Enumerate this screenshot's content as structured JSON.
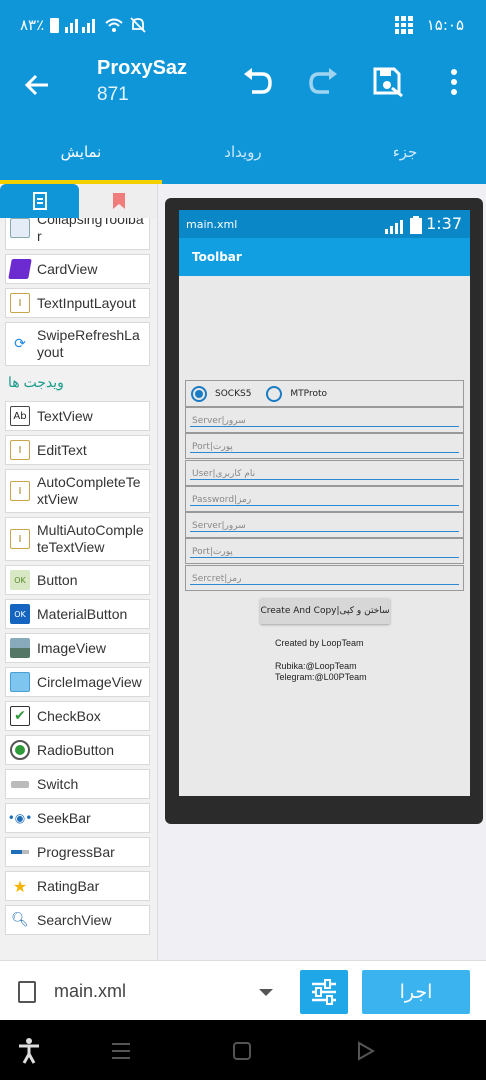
{
  "status_bar": {
    "battery_text": "۸۳٪",
    "time": "۱۵:۰۵"
  },
  "app_bar": {
    "title": "ProxySaz",
    "subtitle": "871",
    "icons": [
      "back-arrow-icon",
      "undo-icon",
      "redo-icon",
      "save-icon",
      "more-vert-icon"
    ]
  },
  "tabs": [
    {
      "label": "نمایش",
      "active": true
    },
    {
      "label": "رویداد",
      "active": false
    },
    {
      "label": "جزء",
      "active": false
    }
  ],
  "palette": {
    "layouts": [
      {
        "label": "CollapsingToolbar",
        "icon": "collapsing-toolbar-icon"
      },
      {
        "label": "CardView",
        "icon": "cardview-icon"
      },
      {
        "label": "TextInputLayout",
        "icon": "textinput-layout-icon"
      },
      {
        "label": "SwipeRefreshLayout",
        "icon": "refresh-icon"
      }
    ],
    "section_title": "ویدجت ها",
    "widgets": [
      {
        "label": "TextView",
        "icon": "textview-icon"
      },
      {
        "label": "EditText",
        "icon": "edittext-icon"
      },
      {
        "label": "AutoCompleteTextView",
        "icon": "autocomplete-icon"
      },
      {
        "label": "MultiAutoCompleteTextView",
        "icon": "multi-autocomplete-icon"
      },
      {
        "label": "Button",
        "icon": "button-icon"
      },
      {
        "label": "MaterialButton",
        "icon": "material-button-icon"
      },
      {
        "label": "ImageView",
        "icon": "imageview-icon"
      },
      {
        "label": "CircleImageView",
        "icon": "circle-imageview-icon"
      },
      {
        "label": "CheckBox",
        "icon": "checkbox-icon"
      },
      {
        "label": "RadioButton",
        "icon": "radiobutton-icon"
      },
      {
        "label": "Switch",
        "icon": "switch-icon"
      },
      {
        "label": "SeekBar",
        "icon": "seekbar-icon"
      },
      {
        "label": "ProgressBar",
        "icon": "progressbar-icon"
      },
      {
        "label": "RatingBar",
        "icon": "star-icon"
      },
      {
        "label": "SearchView",
        "icon": "search-icon"
      }
    ]
  },
  "device": {
    "filename": "main.xml",
    "time": "1:37",
    "toolbar_title": "Toolbar",
    "radio_socks": "SOCKS5",
    "radio_mtproto": "MTProto",
    "fields": [
      "Server|سرور",
      "Port|پورت",
      "User|نام کاربری",
      "Password|رمز",
      "Server|سرور",
      "Port|پورت",
      "Sercret|رمز"
    ],
    "button": "Create And Copy|ساختن و کپی",
    "created_by": "Created by LoopTeam",
    "contact_line1": "Rubika:@LoopTeam",
    "contact_line2": "Telegram:@L00PTeam"
  },
  "bottom_bar": {
    "file": "main.xml",
    "run_label": "اجرا"
  }
}
